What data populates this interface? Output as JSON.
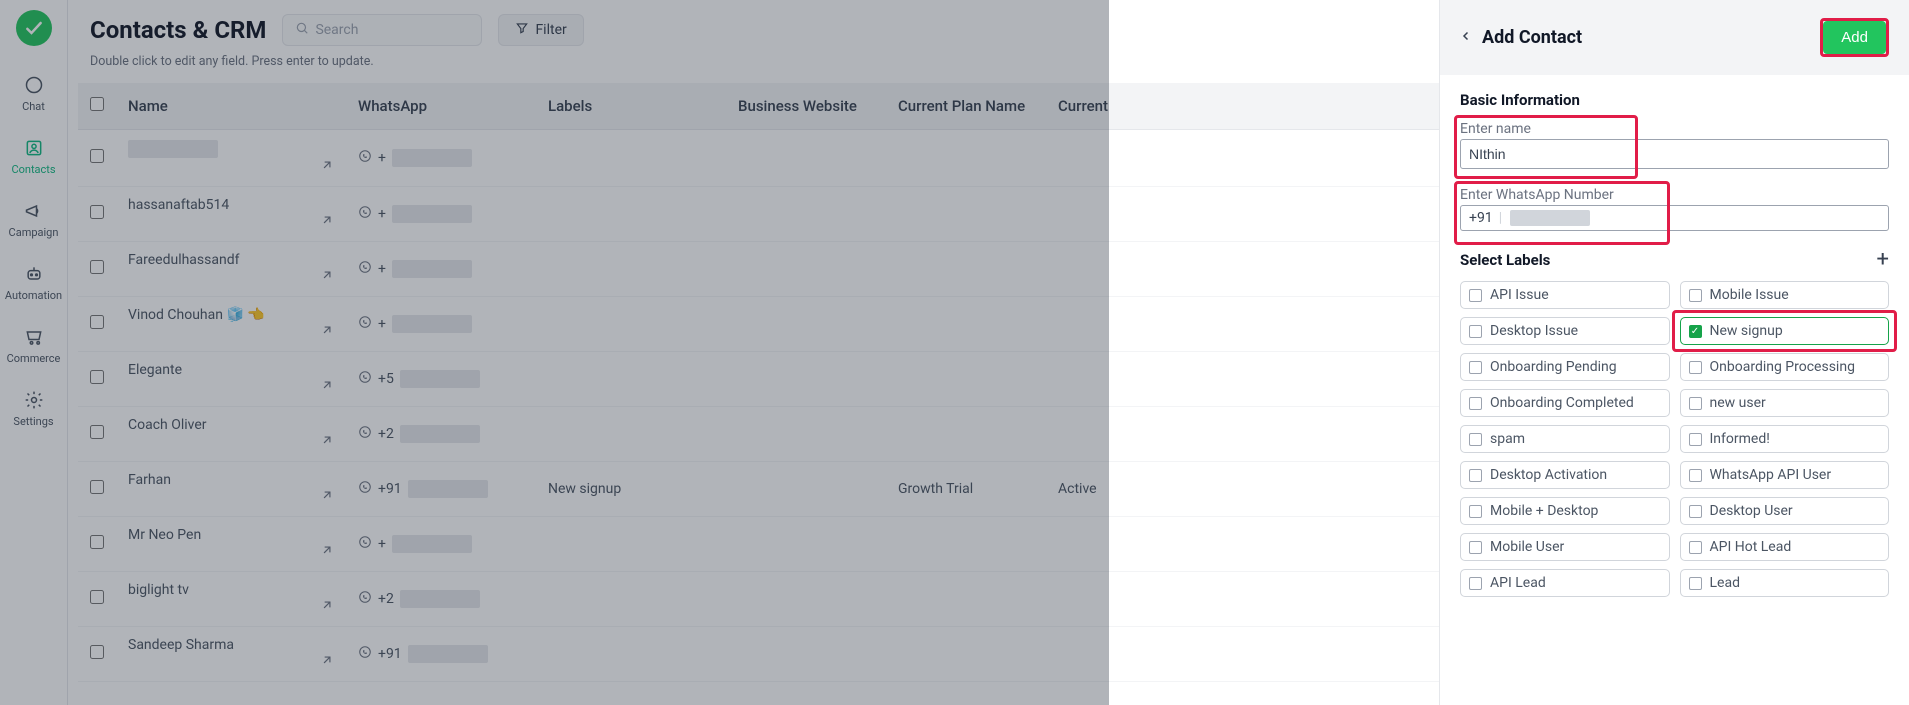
{
  "nav": {
    "items": [
      {
        "label": "Chat"
      },
      {
        "label": "Contacts"
      },
      {
        "label": "Campaign"
      },
      {
        "label": "Automation"
      },
      {
        "label": "Commerce"
      },
      {
        "label": "Settings"
      }
    ]
  },
  "header": {
    "title": "Contacts & CRM",
    "search_placeholder": "Search",
    "filter_label": "Filter",
    "subtext": "Double click to edit any field. Press enter to update."
  },
  "table": {
    "columns": [
      "Name",
      "WhatsApp",
      "Labels",
      "Business Website",
      "Current Plan Name",
      "Current"
    ],
    "rows": [
      {
        "name": "",
        "name_redacted": true,
        "wa_prefix": "+",
        "labels": "",
        "website": "",
        "plan": "",
        "status": ""
      },
      {
        "name": "hassanaftab514",
        "wa_prefix": "+",
        "labels": "",
        "website": "",
        "plan": "",
        "status": ""
      },
      {
        "name": "Fareedulhassandf",
        "wa_prefix": "+",
        "labels": "",
        "website": "",
        "plan": "",
        "status": ""
      },
      {
        "name": "Vinod Chouhan 🧊 👈",
        "wa_prefix": "+",
        "labels": "",
        "website": "",
        "plan": "",
        "status": ""
      },
      {
        "name": "Elegante",
        "wa_prefix": "+5",
        "labels": "",
        "website": "",
        "plan": "",
        "status": ""
      },
      {
        "name": "Coach Oliver",
        "wa_prefix": "+2",
        "labels": "",
        "website": "",
        "plan": "",
        "status": ""
      },
      {
        "name": "Farhan",
        "wa_prefix": "+91",
        "labels": "New signup",
        "website": "",
        "plan": "Growth Trial",
        "status": "Active"
      },
      {
        "name": "Mr Neo Pen",
        "wa_prefix": "+",
        "labels": "",
        "website": "",
        "plan": "",
        "status": ""
      },
      {
        "name": "biglight tv",
        "wa_prefix": "+2",
        "labels": "",
        "website": "",
        "plan": "",
        "status": ""
      },
      {
        "name": "Sandeep Sharma",
        "wa_prefix": "+91",
        "labels": "",
        "website": "",
        "plan": "",
        "status": ""
      }
    ]
  },
  "panel": {
    "title": "Add Contact",
    "add_button": "Add",
    "basic_info_title": "Basic Information",
    "name_label": "Enter name",
    "name_value": "NIthin",
    "whatsapp_label": "Enter WhatsApp Number",
    "whatsapp_code": "+91",
    "select_labels_title": "Select Labels",
    "labels": [
      {
        "text": "API Issue",
        "checked": false
      },
      {
        "text": "Mobile Issue",
        "checked": false
      },
      {
        "text": "Desktop Issue",
        "checked": false
      },
      {
        "text": "New signup",
        "checked": true,
        "highlight": true
      },
      {
        "text": "Onboarding Pending",
        "checked": false
      },
      {
        "text": "Onboarding Processing",
        "checked": false
      },
      {
        "text": "Onboarding Completed",
        "checked": false
      },
      {
        "text": "new user",
        "checked": false
      },
      {
        "text": "spam",
        "checked": false
      },
      {
        "text": "Informed!",
        "checked": false
      },
      {
        "text": "Desktop Activation",
        "checked": false
      },
      {
        "text": "WhatsApp API User",
        "checked": false
      },
      {
        "text": "Mobile + Desktop",
        "checked": false
      },
      {
        "text": "Desktop User",
        "checked": false
      },
      {
        "text": "Mobile User",
        "checked": false
      },
      {
        "text": "API Hot Lead",
        "checked": false
      },
      {
        "text": "API Lead",
        "checked": false
      },
      {
        "text": "Lead",
        "checked": false
      }
    ]
  }
}
